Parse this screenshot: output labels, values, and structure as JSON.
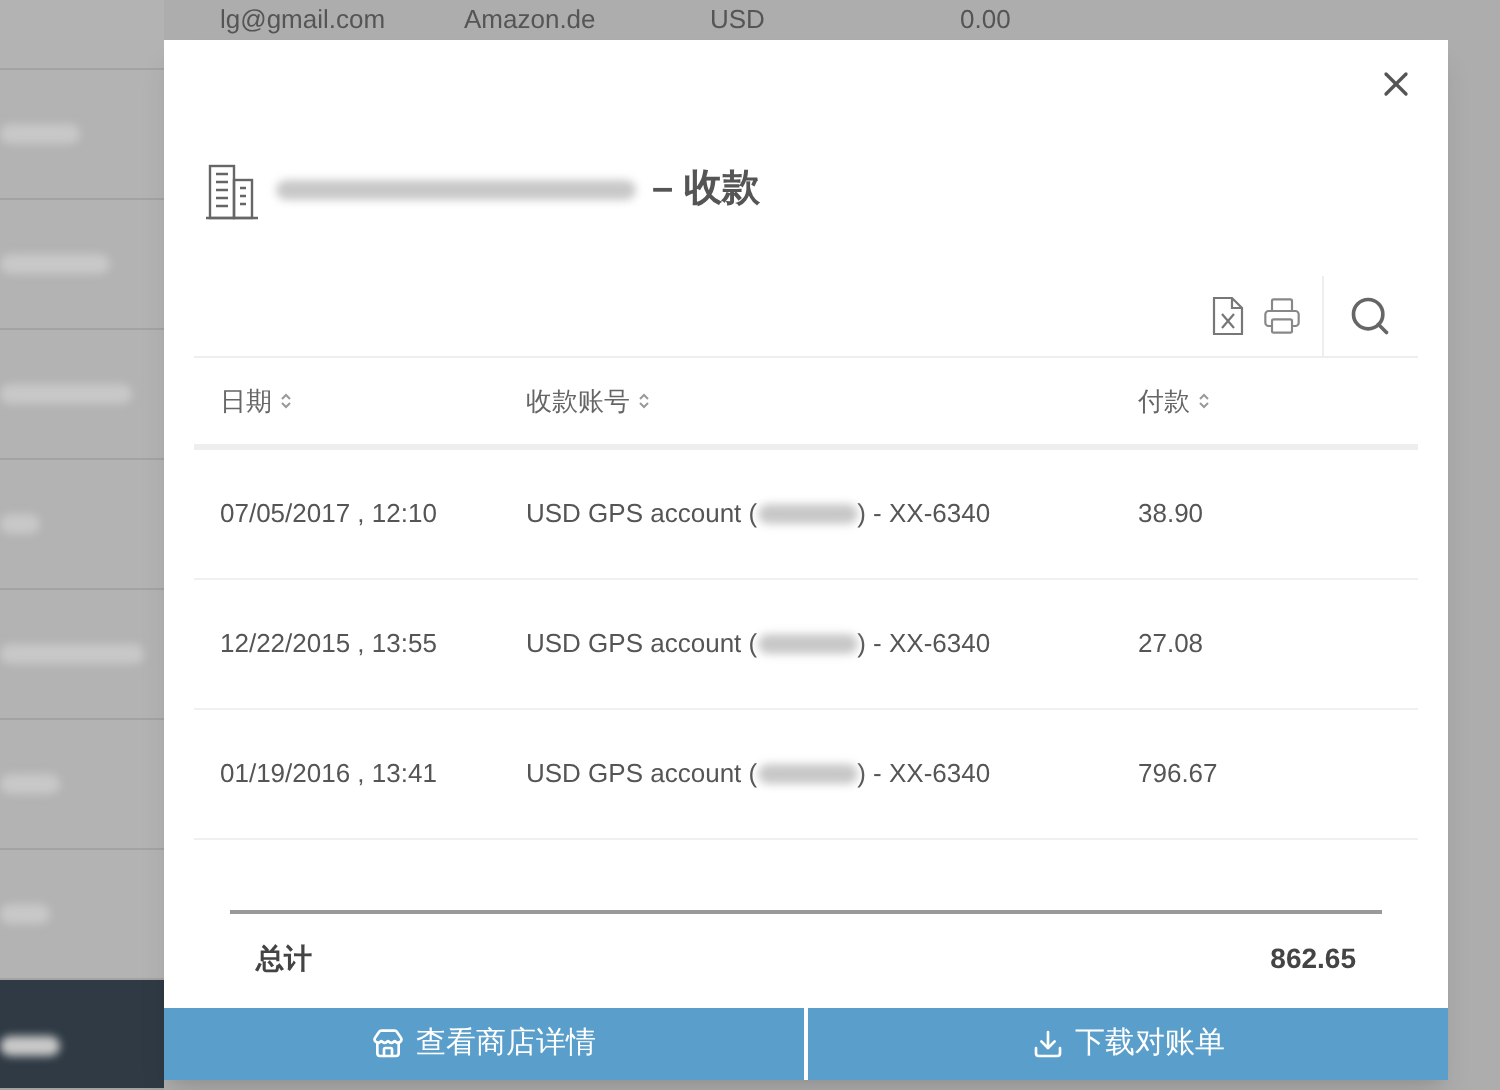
{
  "background": {
    "table_row": [
      "lg@gmail.com",
      "Amazon.de",
      "USD",
      "0.00"
    ],
    "sidebar": {
      "items": [
        {
          "selected": false
        },
        {
          "selected": false
        },
        {
          "selected": false
        },
        {
          "selected": false
        },
        {
          "selected": false
        },
        {
          "selected": false
        },
        {
          "selected": false
        },
        {
          "selected": true
        }
      ]
    }
  },
  "dialog": {
    "title_suffix": "– 收款",
    "table": {
      "columns": [
        "日期",
        "收款账号",
        "付款"
      ],
      "rows": [
        {
          "date": "07/05/2017 , 12:10",
          "account_prefix": "USD GPS account (",
          "account_end": ") - XX-6340",
          "amount": "38.90"
        },
        {
          "date": "12/22/2015 , 13:55",
          "account_prefix": "USD GPS account (",
          "account_end": ") - XX-6340",
          "amount": "27.08"
        },
        {
          "date": "01/19/2016 , 13:41",
          "account_prefix": "USD GPS account (",
          "account_end": ") - XX-6340",
          "amount": "796.67"
        }
      ]
    },
    "total": {
      "label": "总计",
      "value": "862.65"
    },
    "buttons": [
      {
        "kind": "store",
        "label": "查看商店详情"
      },
      {
        "kind": "download",
        "label": "下载对账单"
      }
    ]
  }
}
